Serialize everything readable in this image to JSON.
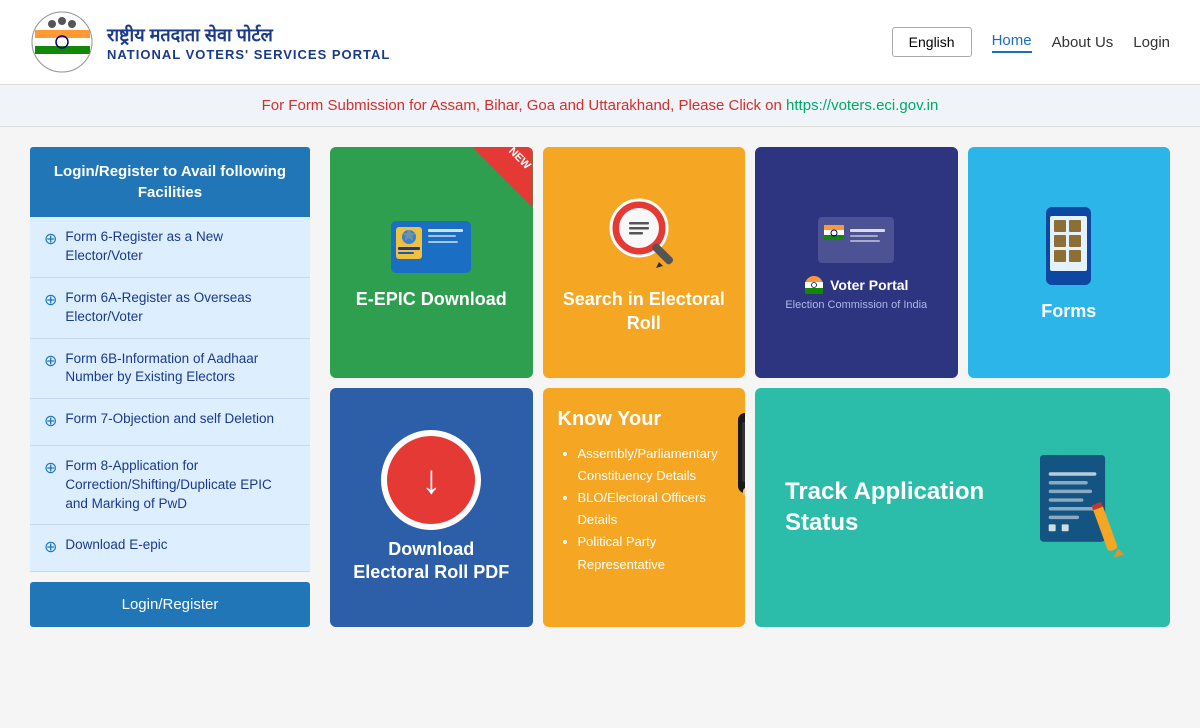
{
  "header": {
    "logo_hindi": "राष्ट्रीय मतदाता सेवा पोर्टल",
    "logo_english": "NATIONAL VOTERS' SERVICES PORTAL",
    "lang_btn": "English",
    "nav": {
      "home": "Home",
      "about": "About Us",
      "login": "Login"
    }
  },
  "announcement": {
    "text_red": "For Form Submission for Assam, Bihar, Goa and Uttarakhand, Please Click on",
    "link_text": "https://voters.eci.gov.in",
    "link_url": "https://voters.eci.gov.in"
  },
  "sidebar": {
    "header": "Login/Register to Avail following Facilities",
    "items": [
      "Form 6-Register as a New Elector/Voter",
      "Form 6A-Register as Overseas Elector/Voter",
      "Form 6B-Information of Aadhaar Number by Existing Electors",
      "Form 7-Objection and self Deletion",
      "Form 8-Application for Correction/Shifting/Duplicate EPIC and Marking of PwD",
      "Download E-epic"
    ],
    "login_btn": "Login/Register"
  },
  "cards": {
    "row1": [
      {
        "id": "eepic",
        "label": "E-EPIC Download",
        "new_badge": "NEW",
        "bg": "#2e9e4f"
      },
      {
        "id": "search",
        "label": "Search in Electoral Roll",
        "bg": "#f5a623"
      },
      {
        "id": "voter-portal",
        "label": "Voter Portal",
        "sublabel": "Election Commission of India",
        "bg": "#2d3480"
      },
      {
        "id": "forms",
        "label": "Forms",
        "bg": "#2cb5e8"
      }
    ],
    "row2": [
      {
        "id": "download",
        "label": "Download Electoral Roll PDF",
        "bg": "#2d5fa8"
      },
      {
        "id": "know",
        "title": "Know Your",
        "items": [
          "Assembly/Parliamentary Constituency Details",
          "BLO/Electoral Officers Details",
          "Political Party Representative"
        ],
        "bg": "#f5a623"
      },
      {
        "id": "track",
        "label": "Track Application Status",
        "bg": "#2cbdaa"
      }
    ]
  }
}
